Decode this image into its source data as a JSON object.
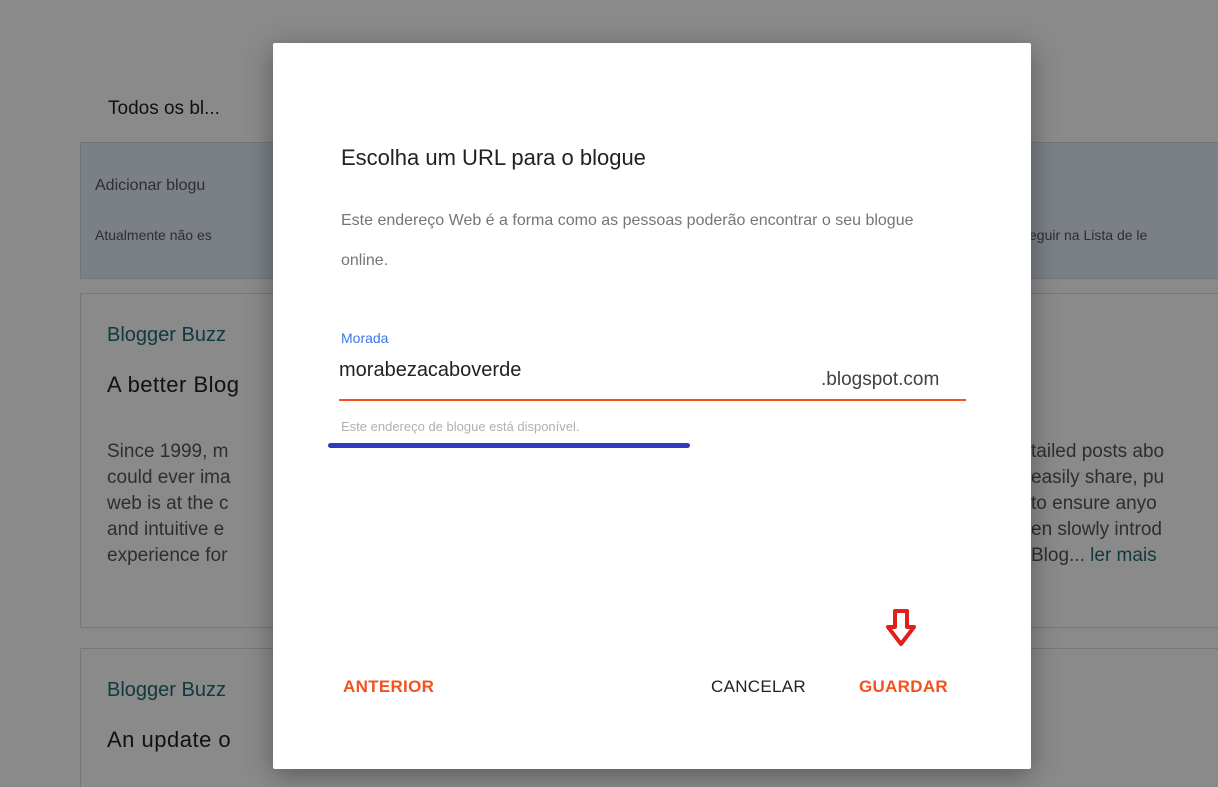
{
  "background": {
    "section_title": "Todos os bl...",
    "notice": {
      "heading": "Adicionar blogu",
      "text_left": "Atualmente não es",
      "text_right": "eguir na Lista de le"
    },
    "cards": [
      {
        "source": "Blogger Buzz",
        "headline": "A better Blog",
        "body_left": [
          "Since 1999, m",
          "could ever ima",
          "web is at the c",
          "and intuitive e",
          "experience for"
        ],
        "body_right": [
          "tailed posts abo",
          "easily share, pu",
          "to ensure anyo",
          "en slowly introd",
          "Blog..."
        ],
        "read_more": "ler mais"
      },
      {
        "source": "Blogger Buzz",
        "headline": "An update o"
      }
    ]
  },
  "dialog": {
    "title": "Escolha um URL para o blogue",
    "description": "Este endereço Web é a forma como as pessoas poderão encontrar o seu blogue online.",
    "field": {
      "label": "Morada",
      "value": "morabezacaboverde",
      "suffix": ".blogspot.com",
      "helper": "Este endereço de blogue está disponível."
    },
    "buttons": {
      "back": "ANTERIOR",
      "cancel": "CANCELAR",
      "save": "GUARDAR"
    }
  },
  "colors": {
    "accent": "#f4511e",
    "label_blue": "#3b78e7",
    "annotation_underline": "#2e3bc0",
    "annotation_arrow": "#e0201a"
  },
  "icons": {
    "annotation_arrow": "arrow-down-icon"
  }
}
